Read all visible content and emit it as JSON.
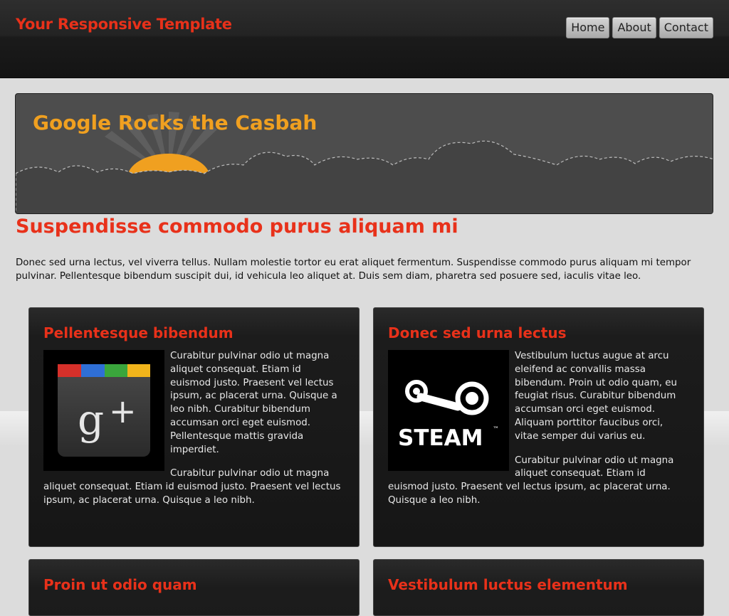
{
  "site": {
    "title": "Your Responsive Template"
  },
  "nav": {
    "items": [
      {
        "label": "Home"
      },
      {
        "label": "About"
      },
      {
        "label": "Contact"
      }
    ]
  },
  "hero": {
    "title": "Google Rocks the Casbah"
  },
  "main": {
    "heading": "Suspendisse commodo purus aliquam mi",
    "intro": "Donec sed urna lectus, vel viverra tellus. Nullam molestie tortor eu erat aliquet fermentum. Suspendisse commodo purus aliquam mi tempor pulvinar. Pellentesque bibendum suscipit dui, id vehicula leo aliquet at. Duis sem diam, pharetra sed posuere sed, iaculis vitae leo."
  },
  "cards": [
    {
      "title": "Pellentesque bibendum",
      "image": "google-plus-icon",
      "paragraphs": [
        "Curabitur pulvinar odio ut magna aliquet consequat. Etiam id euismod justo. Praesent vel lectus ipsum, ac placerat urna. Quisque a leo nibh. Curabitur bibendum accumsan orci eget euismod. Pellentesque mattis gravida imperdiet.",
        "Curabitur pulvinar odio ut magna aliquet consequat. Etiam id euismod justo. Praesent vel lectus ipsum, ac placerat urna. Quisque a leo nibh."
      ]
    },
    {
      "title": "Donec sed urna lectus",
      "image": "steam-logo-icon",
      "image_text": "STEAM",
      "image_tm": "™",
      "paragraphs": [
        "Vestibulum luctus augue at arcu eleifend ac convallis massa bibendum. Proin ut odio quam, eu feugiat risus. Curabitur bibendum accumsan orci eget euismod. Aliquam porttitor faucibus orci, vitae semper dui varius eu.",
        "Curabitur pulvinar odio ut magna aliquet consequat. Etiam id euismod justo. Praesent vel lectus ipsum, ac placerat urna. Quisque a leo nibh."
      ]
    },
    {
      "title": "Proin ut odio quam"
    },
    {
      "title": "Vestibulum luctus elementum"
    }
  ],
  "colors": {
    "accent": "#e8311a",
    "hero_title": "#f0a020",
    "header_bg": "#1b1b1b",
    "page_bg": "#dcdcdc",
    "card_bg": "#161616"
  }
}
